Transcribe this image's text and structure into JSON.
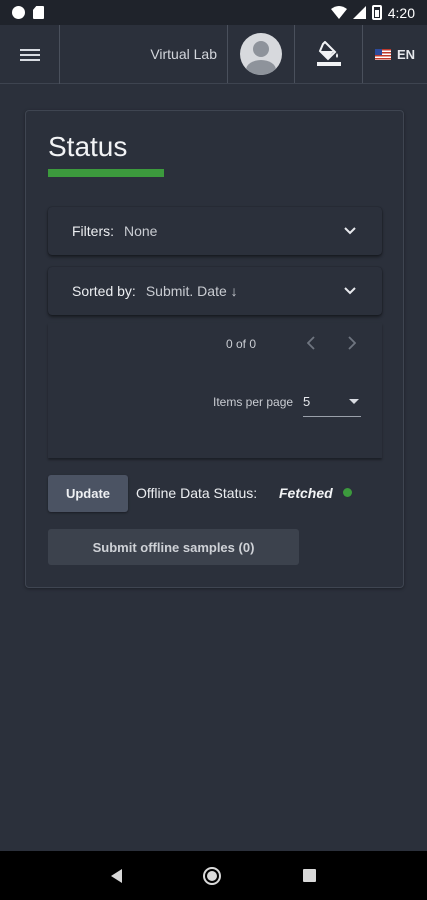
{
  "status_bar": {
    "time": "4:20"
  },
  "app_bar": {
    "title": "Virtual Lab",
    "language": "EN"
  },
  "card": {
    "title": "Status",
    "filters": {
      "label": "Filters:",
      "value": "None"
    },
    "sort": {
      "label": "Sorted by:",
      "value": "Submit. Date ↓"
    },
    "pagination": {
      "range": "0 of 0",
      "items_per_page_label": "Items per page",
      "items_per_page": "5"
    },
    "update_label": "Update",
    "offline_label": "Offline Data Status:",
    "offline_value": "Fetched",
    "submit_label": "Submit offline samples (0)"
  },
  "colors": {
    "accent": "#3c9a3d",
    "background": "#2b303b"
  }
}
